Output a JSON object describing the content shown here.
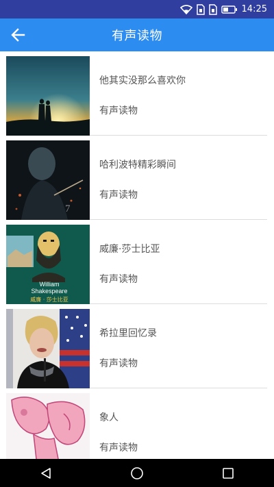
{
  "status_bar": {
    "time": "14:25"
  },
  "app_bar": {
    "title": "有声读物"
  },
  "list": [
    {
      "name": "他其实没那么喜欢你",
      "category": "有声读物",
      "thumb": "silhouette-couple-sunset-image"
    },
    {
      "name": "哈利波特精彩瞬间",
      "category": "有声读物",
      "thumb": "harry-potter-movie-poster-image"
    },
    {
      "name": "威廉·莎士比亚",
      "category": "有声读物",
      "thumb": "shakespeare-portrait-image",
      "thumb_caption_en": "William Shakespeare",
      "thumb_caption_cn": "威廉 · 莎士比亚"
    },
    {
      "name": "希拉里回忆录",
      "category": "有声读物",
      "thumb": "speaker-with-flag-image"
    },
    {
      "name": "象人",
      "category": "有声读物",
      "thumb": "pink-elephant-cartoon-image"
    }
  ],
  "colors": {
    "status": "#303f9f",
    "app_bar": "#2d8cf0",
    "text": "#555555"
  }
}
